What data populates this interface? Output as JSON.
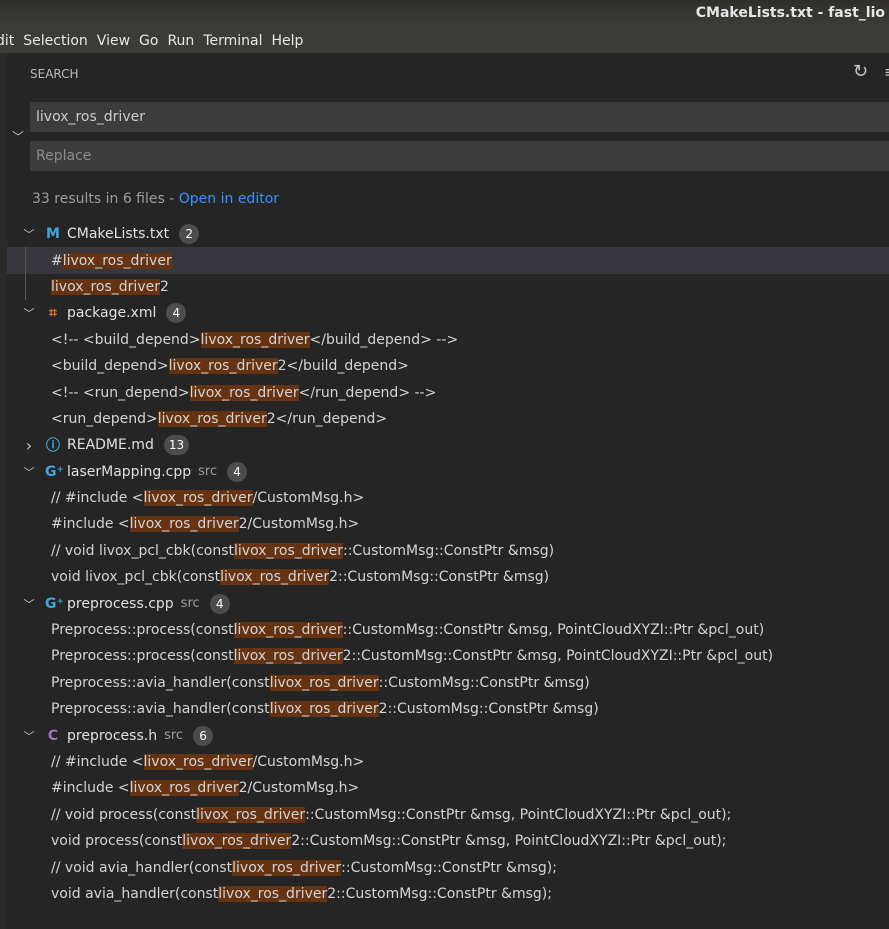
{
  "window_title": "CMakeLists.txt - fast_lio",
  "menu": [
    "dit",
    "Selection",
    "View",
    "Go",
    "Run",
    "Terminal",
    "Help"
  ],
  "search": {
    "header": "SEARCH",
    "query": "livox_ros_driver",
    "replace_placeholder": "Replace",
    "summary": "33 results in 6 files - ",
    "open_in_editor": "Open in editor"
  },
  "colors": {
    "match_bg": "#653312",
    "link": "#3794ff",
    "badge": "#4d4d4d"
  },
  "files": [
    {
      "name": "CMakeLists.txt",
      "dir": "",
      "count": "2",
      "icon": "cmake-icon",
      "glyph": "M",
      "color": "#3fa7e0",
      "expanded": true,
      "matches": [
        {
          "pre": "# ",
          "m": "livox_ros_driver",
          "post": "",
          "selected": true
        },
        {
          "pre": "",
          "m": "livox_ros_driver",
          "post": "2"
        }
      ]
    },
    {
      "name": "package.xml",
      "dir": "",
      "count": "4",
      "icon": "rss-icon",
      "glyph": "⌗",
      "color": "#e37933",
      "expanded": true,
      "matches": [
        {
          "pre": "<!-- <build_depend>",
          "m": "livox_ros_driver",
          "post": "</build_depend> -->"
        },
        {
          "pre": "<build_depend>",
          "m": "livox_ros_driver",
          "post": "2</build_depend>"
        },
        {
          "pre": "<!-- <run_depend>",
          "m": "livox_ros_driver",
          "post": "</run_depend> -->"
        },
        {
          "pre": "<run_depend>",
          "m": "livox_ros_driver",
          "post": "2</run_depend>"
        }
      ]
    },
    {
      "name": "README.md",
      "dir": "",
      "count": "13",
      "icon": "info-icon",
      "glyph": "ⓘ",
      "color": "#3fa7e0",
      "expanded": false,
      "matches": []
    },
    {
      "name": "laserMapping.cpp",
      "dir": "src",
      "count": "4",
      "icon": "cpp-icon",
      "glyph": "G⁺",
      "color": "#3fa7e0",
      "expanded": true,
      "matches": [
        {
          "pre": "// #include <",
          "m": "livox_ros_driver",
          "post": "/CustomMsg.h>"
        },
        {
          "pre": "#include <",
          "m": "livox_ros_driver",
          "post": "2/CustomMsg.h>"
        },
        {
          "pre": "// void livox_pcl_cbk(const ",
          "m": "livox_ros_driver",
          "post": "::CustomMsg::ConstPtr &msg)"
        },
        {
          "pre": "void livox_pcl_cbk(const ",
          "m": "livox_ros_driver",
          "post": "2::CustomMsg::ConstPtr &msg)"
        }
      ]
    },
    {
      "name": "preprocess.cpp",
      "dir": "src",
      "count": "4",
      "icon": "cpp-icon",
      "glyph": "G⁺",
      "color": "#3fa7e0",
      "expanded": true,
      "matches": [
        {
          "pre": "Preprocess::process(const ",
          "m": "livox_ros_driver",
          "post": "::CustomMsg::ConstPtr &msg, PointCloudXYZI::Ptr &pcl_out)"
        },
        {
          "pre": "Preprocess::process(const ",
          "m": "livox_ros_driver",
          "post": "2::CustomMsg::ConstPtr &msg, PointCloudXYZI::Ptr &pcl_out)"
        },
        {
          "pre": "Preprocess::avia_handler(const ",
          "m": "livox_ros_driver",
          "post": "::CustomMsg::ConstPtr &msg)"
        },
        {
          "pre": "Preprocess::avia_handler(const ",
          "m": "livox_ros_driver",
          "post": "2::CustomMsg::ConstPtr &msg)"
        }
      ]
    },
    {
      "name": "preprocess.h",
      "dir": "src",
      "count": "6",
      "icon": "c-header-icon",
      "glyph": "C",
      "color": "#a074c4",
      "expanded": true,
      "matches": [
        {
          "pre": "// #include <",
          "m": "livox_ros_driver",
          "post": "/CustomMsg.h>"
        },
        {
          "pre": "#include <",
          "m": "livox_ros_driver",
          "post": "2/CustomMsg.h>"
        },
        {
          "pre": "// void process(const ",
          "m": "livox_ros_driver",
          "post": "::CustomMsg::ConstPtr &msg, PointCloudXYZI::Ptr &pcl_out);"
        },
        {
          "pre": "void process(const ",
          "m": "livox_ros_driver",
          "post": "2::CustomMsg::ConstPtr &msg, PointCloudXYZI::Ptr &pcl_out);"
        },
        {
          "pre": "// void avia_handler(const ",
          "m": "livox_ros_driver",
          "post": "::CustomMsg::ConstPtr &msg);"
        },
        {
          "pre": "void avia_handler(const ",
          "m": "livox_ros_driver",
          "post": "2::CustomMsg::ConstPtr &msg);"
        }
      ]
    }
  ]
}
